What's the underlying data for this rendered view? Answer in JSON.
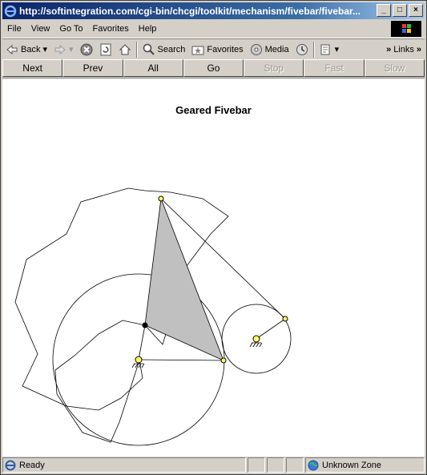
{
  "window": {
    "title": "http://softintegration.com/cgi-bin/chcgi/toolkit/mechanism/fivebar/fivebar...",
    "buttons": {
      "minimize": "_",
      "maximize": "□",
      "close": "×"
    }
  },
  "menu": [
    "File",
    "View",
    "Go To",
    "Favorites",
    "Help"
  ],
  "toolbar": {
    "back": "Back",
    "search": "Search",
    "favorites": "Favorites",
    "media": "Media",
    "links": "Links"
  },
  "nav_buttons": [
    {
      "label": "Next",
      "enabled": true
    },
    {
      "label": "Prev",
      "enabled": true
    },
    {
      "label": "All",
      "enabled": true
    },
    {
      "label": "Go",
      "enabled": true
    },
    {
      "label": "Stop",
      "enabled": false
    },
    {
      "label": "Fast",
      "enabled": false
    },
    {
      "label": "Slow",
      "enabled": false
    }
  ],
  "page": {
    "title": "Geared Fivebar"
  },
  "status": {
    "text": "Ready",
    "zone": "Unknown Zone"
  },
  "colors": {
    "title_gradient_start": "#0a246a",
    "coupler_fill": "#c0c0c0",
    "joint_marker": "#ffff66"
  }
}
